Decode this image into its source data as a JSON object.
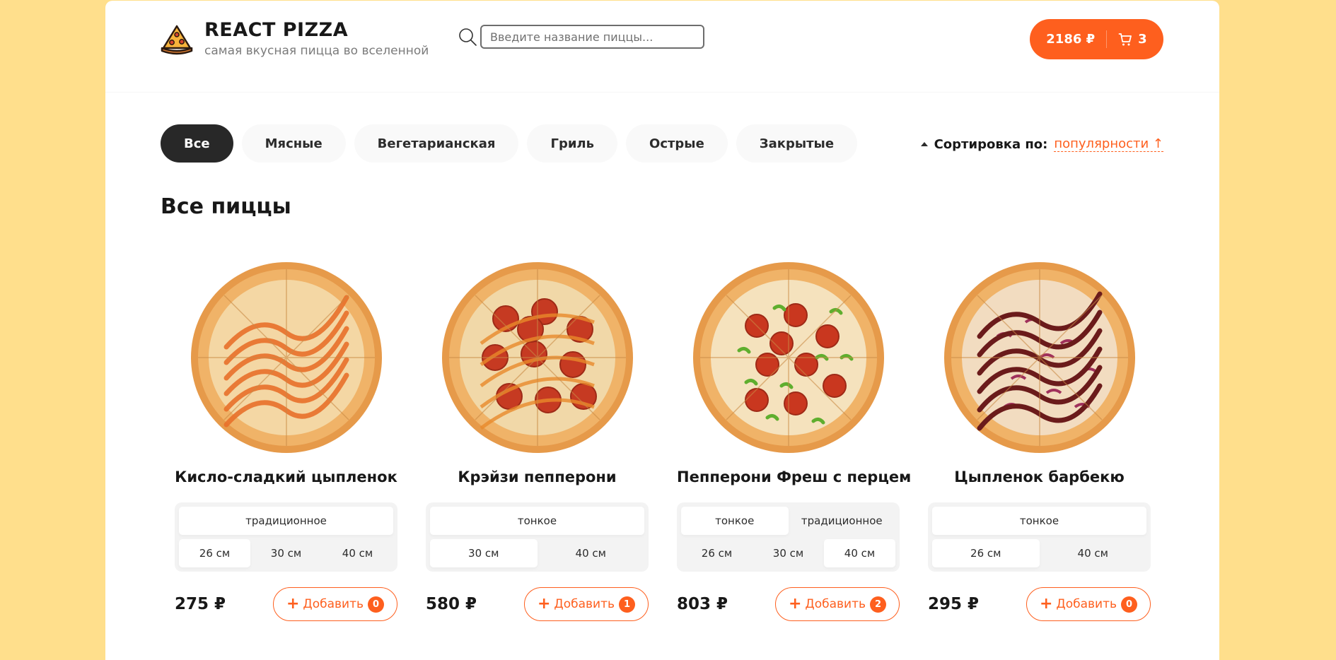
{
  "colors": {
    "accent": "#fe5f1e",
    "page_bg": "#ffdf8c",
    "dark": "#282828"
  },
  "header": {
    "title": "REACT PIZZA",
    "subtitle": "самая вкусная пицца во вселенной",
    "search_placeholder": "Введите название пиццы...",
    "cart_sum": "2186 ₽",
    "cart_count": "3"
  },
  "categories": [
    "Все",
    "Мясные",
    "Вегетарианская",
    "Гриль",
    "Острые",
    "Закрытые"
  ],
  "active_category": "Все",
  "sort": {
    "label": "Сортировка по:",
    "value": "популярности ↑"
  },
  "content_title": "Все пиццы",
  "add_label": "Добавить",
  "pizzas": [
    {
      "title": "Кисло-сладкий цыпленок",
      "types": [
        "традиционное"
      ],
      "active_type": 0,
      "sizes": [
        "26 см",
        "30 см",
        "40 см"
      ],
      "active_size": 0,
      "price": "275 ₽",
      "count": "0",
      "topping": "sweet"
    },
    {
      "title": "Крэйзи пепперони",
      "types": [
        "тонкое"
      ],
      "active_type": 0,
      "sizes": [
        "30 см",
        "40 см"
      ],
      "active_size": 0,
      "price": "580 ₽",
      "count": "1",
      "topping": "pepperoni-sauce"
    },
    {
      "title": "Пепперони Фреш с перцем",
      "types": [
        "тонкое",
        "традиционное"
      ],
      "active_type": 0,
      "sizes": [
        "26 см",
        "30 см",
        "40 см"
      ],
      "active_size": 2,
      "price": "803 ₽",
      "count": "2",
      "topping": "pepperoni-pepper"
    },
    {
      "title": "Цыпленок барбекю",
      "types": [
        "тонкое"
      ],
      "active_type": 0,
      "sizes": [
        "26 см",
        "40 см"
      ],
      "active_size": 0,
      "price": "295 ₽",
      "count": "0",
      "topping": "bbq"
    }
  ]
}
